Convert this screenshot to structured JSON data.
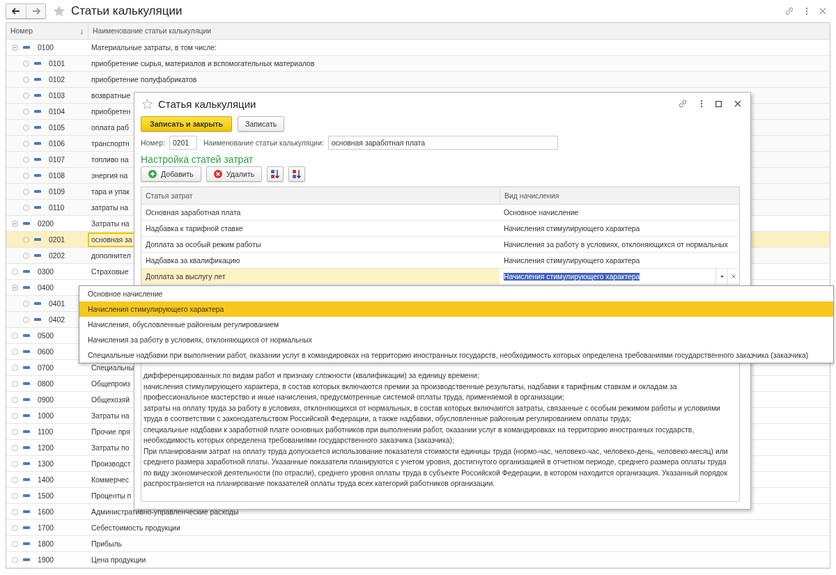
{
  "page": {
    "title": "Статьи калькуляции"
  },
  "list": {
    "columns": [
      {
        "label": "Номер",
        "sort_mark": "↓"
      },
      {
        "label": "Наименование статьи калькуляции"
      }
    ],
    "rows": [
      {
        "code": "0100",
        "name": "Материальные затраты, в том числе:",
        "selected": false,
        "expanded": true,
        "children": [
          {
            "code": "0101",
            "name": "приобретение сырья, материалов и вспомогательных материалов",
            "selected": false
          },
          {
            "code": "0102",
            "name": "приобретение полуфабрикатов",
            "selected": false
          },
          {
            "code": "0103",
            "name": "возвратные",
            "selected": false
          },
          {
            "code": "0104",
            "name": "приобретен",
            "selected": false
          },
          {
            "code": "0105",
            "name": "оплата раб",
            "selected": false
          },
          {
            "code": "0106",
            "name": "транспортн",
            "selected": false
          },
          {
            "code": "0107",
            "name": "топливо на",
            "selected": false
          },
          {
            "code": "0108",
            "name": "энергия на",
            "selected": false
          },
          {
            "code": "0109",
            "name": "тара и упак",
            "selected": false
          },
          {
            "code": "0110",
            "name": "затраты на",
            "selected": false
          }
        ]
      },
      {
        "code": "0200",
        "name": "Затраты на",
        "selected": false,
        "expanded": true,
        "children": [
          {
            "code": "0201",
            "name": "основная за",
            "selected": true
          },
          {
            "code": "0202",
            "name": "дополнител",
            "selected": false
          }
        ]
      },
      {
        "code": "0300",
        "name": "Страховые",
        "selected": false
      },
      {
        "code": "0400",
        "selected": false,
        "expanded": true,
        "children": [
          {
            "code": "0401",
            "selected": false
          },
          {
            "code": "0402",
            "selected": false
          }
        ]
      },
      {
        "code": "0500",
        "selected": false
      },
      {
        "code": "0600",
        "selected": false
      },
      {
        "code": "0700",
        "name": "Специальны",
        "selected": false
      },
      {
        "code": "0800",
        "name": "Общепроиз",
        "selected": false
      },
      {
        "code": "0900",
        "name": "Общехозяй",
        "selected": false
      },
      {
        "code": "1000",
        "name": "Затраты на",
        "selected": false
      },
      {
        "code": "1100",
        "name": "Прочие пря",
        "selected": false
      },
      {
        "code": "1200",
        "name": "Затраты по",
        "selected": false
      },
      {
        "code": "1300",
        "name": "Производст",
        "selected": false
      },
      {
        "code": "1400",
        "name": "Коммерчес",
        "selected": false
      },
      {
        "code": "1500",
        "name": "Проценты п",
        "selected": false
      },
      {
        "code": "1600",
        "name": "Административно-управленческие расходы",
        "selected": false
      },
      {
        "code": "1700",
        "name": "Себестоимость продукции",
        "selected": false
      },
      {
        "code": "1800",
        "name": "Прибыль",
        "selected": false
      },
      {
        "code": "1900",
        "name": "Цена продукции",
        "selected": false
      }
    ]
  },
  "dialog": {
    "title": "Статья калькуляции",
    "buttons": [
      {
        "label": "Записать и закрыть",
        "kind": "primary"
      },
      {
        "label": "Записать",
        "kind": "default"
      }
    ],
    "number": {
      "label": "Номер:",
      "value": "0201"
    },
    "name": {
      "label": "Наименование статьи калькуляции:",
      "value": "основная заработная плата"
    },
    "section_title": "Настройка статей затрат",
    "toolbar": [
      {
        "label": "Добавить",
        "kind": "add"
      },
      {
        "label": "Удалить",
        "kind": "delete"
      },
      {
        "kind": "sort_asc"
      },
      {
        "kind": "sort_desc"
      }
    ],
    "table": {
      "columns": [
        "Статья затрат",
        "Вид начисления"
      ],
      "rows": [
        {
          "item": "Основная заработная плата",
          "accrual": "Основное начисление",
          "selected": false,
          "editing": false
        },
        {
          "item": "Надбавка к тарифной ставке",
          "accrual": "Начисления стимулирующего характера",
          "selected": false,
          "editing": false
        },
        {
          "item": "Доплата за особый режим работы",
          "accrual": "Начисления за работу в условиях, отклоняющихся от нормальных",
          "selected": false,
          "editing": false
        },
        {
          "item": "Надбавка за квалификацию",
          "accrual": "Начисления стимулирующего характера",
          "selected": false,
          "editing": false
        },
        {
          "item": "Доплата за выслугу лет",
          "accrual": "Начисления стимулирующего характера",
          "selected": true,
          "editing": true
        }
      ]
    },
    "description": [
      "дифференцированных по видам работ и признаку сложности (квалификации) за единицу времени;",
      "начисления стимулирующего характера, в состав которых включаются премии за производственные результаты, надбавки к тарифным ставкам и окладам за профессиональное мастерство и иные начисления, предусмотренные системой оплаты труда, применяемой в организации;",
      "затраты на оплату труда за работу в условиях, отклоняющихся от нормальных, в состав которых включаются затраты, связанные с особым режимом работы и условиями труда в соответствии с законодательством Российской Федерации, а также надбавки, обусловленные районным регулированием оплаты труда;",
      "специальные надбавки к заработной плате основных работников при выполнении работ, оказании услуг в командировках на территорию иностранных государств, необходимость которых определена требованиями государственного заказчика (заказчика);",
      "При планировании затрат на оплату труда допускается использование показателя стоимости единицы труда (нормо-час, человеко-час, человеко-день, человеко-месяц) или среднего размера заработной платы. Указанные показатели планируются с учетом уровня, достигнутого организацией в отчетном периоде, среднего размера оплаты труда по виду экономической деятельности (по отрасли), среднего уровня оплаты труда в субъекте Российской Федерации, в котором находится организация. Указанный порядок распространяется на планирование показателей оплаты труда всех категорий работников организации."
    ]
  },
  "dropdown": {
    "options": [
      {
        "label": "Основное начисление",
        "selected": false
      },
      {
        "label": "Начисления стимулирующего характера",
        "selected": true
      },
      {
        "label": "Начисления, обусловленные районным регулированием",
        "selected": false
      },
      {
        "label": "Начисления за работу в условиях, отклоняющихся от нормальных",
        "selected": false
      },
      {
        "label": "Специальные надбавки при выполнении работ, оказании услуг в командировках на территорию иностранных государств, необходимость которых определена требованиями государственного заказчика (заказчика)",
        "selected": false
      }
    ]
  }
}
